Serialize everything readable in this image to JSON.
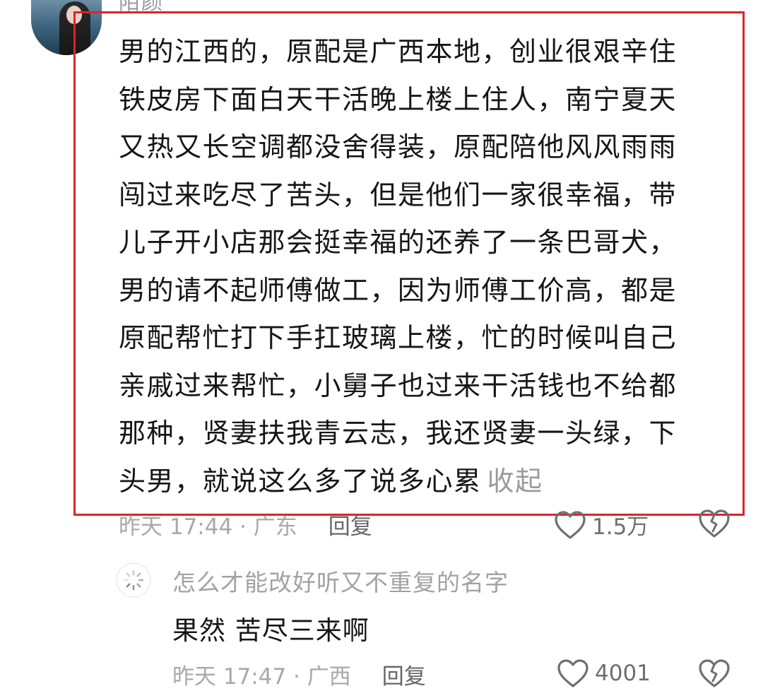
{
  "comment": {
    "username": "陌颜",
    "body_lines": [
      "男的江西的，原配是广西本地，创业很艰辛住",
      "铁皮房下面白天干活晚上楼上住人，南宁夏天",
      "又热又长空调都没舍得装，原配陪他风风雨雨",
      "闯过来吃尽了苦头，但是他们一家很幸福，带",
      "儿子开小店那会挺幸福的还养了一条巴哥犬，",
      "男的请不起师傅做工，因为师傅工价高，都是",
      "原配帮忙打下手扛玻璃上楼，忙的时候叫自己",
      "亲戚过来帮忙，小舅子也过来干活钱也不给都",
      "那种，贤妻扶我青云志，我还贤妻一头绿，下",
      "头男，就说这么多了说多心累"
    ],
    "collapse_label": "收起",
    "time_location": "昨天 17:44 · 广东",
    "reply_label": "回复",
    "like_count": "1.5万"
  },
  "reply": {
    "username": "怎么才能改好听又不重复的名字",
    "text": "果然 苦尽三来啊",
    "time_location": "昨天 17:47 · 广西",
    "reply_label": "回复",
    "like_count": "4001"
  },
  "colors": {
    "highlight_border": "#d9262b",
    "meta_text": "#a8a8a8",
    "body_text": "#161616"
  }
}
